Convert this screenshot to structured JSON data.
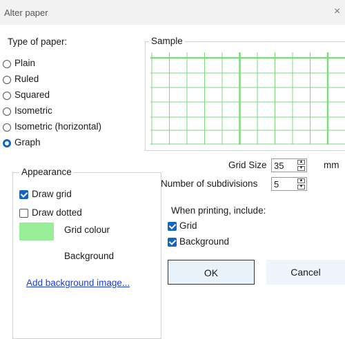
{
  "window": {
    "title": "Alter paper",
    "close_glyph": "×"
  },
  "paper_type": {
    "label": "Type of paper:",
    "options": [
      "Plain",
      "Ruled",
      "Squared",
      "Isometric",
      "Isometric (horizontal)",
      "Graph"
    ],
    "selected": "Graph"
  },
  "sample": {
    "label": "Sample",
    "grid_color": "#7fd97f"
  },
  "appearance": {
    "label": "Appearance",
    "draw_grid": {
      "label": "Draw grid",
      "checked": true
    },
    "draw_dotted": {
      "label": "Draw dotted",
      "checked": false
    },
    "grid_colour": {
      "label": "Grid colour",
      "swatch": "#98ee98"
    },
    "background": {
      "label": "Background"
    },
    "add_background_link": "Add background image..."
  },
  "grid_size": {
    "label": "Grid Size",
    "value": "35",
    "unit": "mm"
  },
  "subdivisions": {
    "label": "Number of subdivisions",
    "value": "5"
  },
  "printing": {
    "label": "When printing, include:",
    "grid": {
      "label": "Grid",
      "checked": true
    },
    "background": {
      "label": "Background",
      "checked": true
    }
  },
  "buttons": {
    "ok": "OK",
    "cancel": "Cancel"
  },
  "colors": {
    "accent": "#1565c0",
    "link": "#1a3fd6",
    "ok_bg": "#e8f2fb",
    "cancel_bg": "#eff5fc"
  }
}
